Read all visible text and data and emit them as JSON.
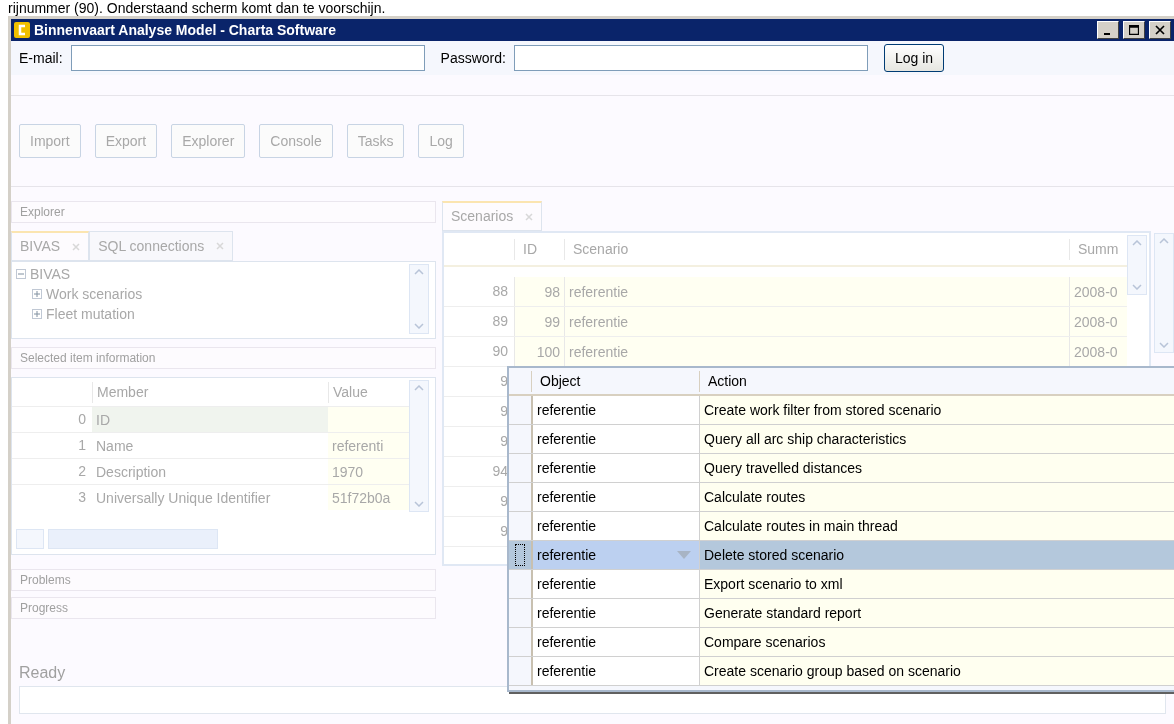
{
  "caption": "rijnummer (90). Onderstaand scherm komt dan te voorschijn.",
  "window": {
    "title": "Binnenvaart Analyse Model - Charta Software"
  },
  "login": {
    "email_label": "E-mail:",
    "password_label": "Password:",
    "button": "Log in"
  },
  "toolbar": [
    {
      "label": "Import",
      "disabled": true
    },
    {
      "label": "Export",
      "disabled": true
    },
    {
      "label": "Explorer",
      "disabled": true
    },
    {
      "label": "Console",
      "disabled": true
    },
    {
      "label": "Tasks",
      "disabled": true
    },
    {
      "label": "Log",
      "disabled": true
    }
  ],
  "explorer": {
    "title": "Explorer",
    "tabs": [
      {
        "label": "BIVAS",
        "selected": true
      },
      {
        "label": "SQL connections",
        "selected": false
      }
    ],
    "tree": [
      {
        "label": "BIVAS",
        "expanded": true,
        "children": [
          {
            "label": "Work scenarios",
            "expanded": false
          },
          {
            "label": "Fleet mutation",
            "expanded": false
          }
        ]
      }
    ]
  },
  "selected_item": {
    "title": "Selected item information",
    "columns": [
      "Member",
      "Value"
    ],
    "rows": [
      {
        "index": "0",
        "member": "ID"
      },
      {
        "index": "1",
        "member": "Name",
        "value": "referenti"
      },
      {
        "index": "2",
        "member": "Description",
        "value": "1970"
      },
      {
        "index": "3",
        "member": "Universally Unique Identifier",
        "value": "51f72b0a"
      }
    ]
  },
  "problems": {
    "title": "Problems"
  },
  "progress": {
    "title": "Progress"
  },
  "status": "Ready",
  "scenarios": {
    "tabs": [
      {
        "label": "Scenarios",
        "selected": true
      }
    ],
    "columns": [
      "ID",
      "Scenario",
      "Summ"
    ],
    "rows": [
      {
        "row": "88",
        "id": "98",
        "scenario": "referentie",
        "summary": "2008-0"
      },
      {
        "row": "89",
        "id": "99",
        "scenario": "referentie",
        "summary": "2008-0"
      },
      {
        "row": "90",
        "id": "100",
        "scenario": "referentie",
        "summary": "2008-0"
      },
      {
        "row": "9"
      },
      {
        "row": "9"
      },
      {
        "row": "9"
      },
      {
        "row": "94"
      },
      {
        "row": "9"
      },
      {
        "row": "9"
      }
    ]
  },
  "actions_dialog": {
    "columns": [
      "Object",
      "Action"
    ],
    "rows": [
      {
        "object": "referentie",
        "action": "Create work filter from stored scenario",
        "selected": false
      },
      {
        "object": "referentie",
        "action": "Query all arc ship characteristics",
        "selected": false
      },
      {
        "object": "referentie",
        "action": "Query travelled distances",
        "selected": false
      },
      {
        "object": "referentie",
        "action": "Calculate routes",
        "selected": false
      },
      {
        "object": "referentie",
        "action": "Calculate routes in main thread",
        "selected": false
      },
      {
        "object": "referentie",
        "action": "Delete stored scenario",
        "selected": true
      },
      {
        "object": "referentie",
        "action": "Export scenario to xml",
        "selected": false
      },
      {
        "object": "referentie",
        "action": "Generate standard report",
        "selected": false
      },
      {
        "object": "referentie",
        "action": "Compare scenarios",
        "selected": false
      },
      {
        "object": "referentie",
        "action": "Create scenario group based on scenario",
        "selected": false
      }
    ]
  }
}
